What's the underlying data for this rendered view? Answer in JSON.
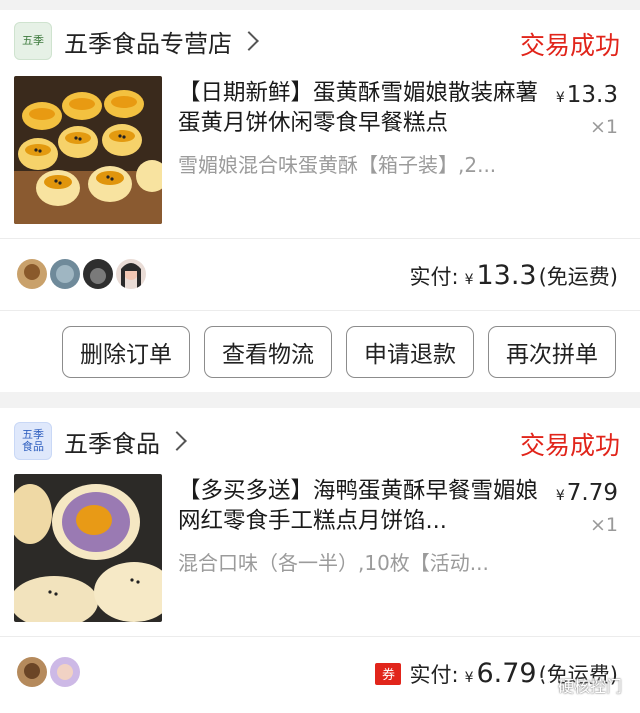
{
  "orders": [
    {
      "store": {
        "logo_text": "五季",
        "name": "五季食品专营店"
      },
      "status": "交易成功",
      "item": {
        "title": "【日期新鲜】蛋黄酥雪媚娘散装麻薯蛋黄月饼休闲零食早餐糕点",
        "spec": "雪媚娘混合味蛋黄酥【箱子装】,2...",
        "currency": "¥",
        "price": "13.3",
        "qty": "×1"
      },
      "payment": {
        "label": "实付:",
        "currency": "¥",
        "amount": "13.3",
        "shipping": "(免运费)"
      },
      "actions": [
        "删除订单",
        "查看物流",
        "申请退款",
        "再次拼单"
      ]
    },
    {
      "store": {
        "logo_text": "五季食品",
        "name": "五季食品"
      },
      "status": "交易成功",
      "item": {
        "title": "【多买多送】海鸭蛋黄酥早餐雪媚娘网红零食手工糕点月饼馅...",
        "spec": "混合口味（各一半）,10枚【活动...",
        "currency": "¥",
        "price": "7.79",
        "qty": "×1"
      },
      "payment": {
        "coupon": "券",
        "label": "实付:",
        "currency": "¥",
        "amount": "6.79",
        "shipping": "(免运费)"
      }
    }
  ],
  "watermark": "硬核控门",
  "colors": {
    "status": "#e1251b",
    "coupon_bg": "#e1251b"
  }
}
